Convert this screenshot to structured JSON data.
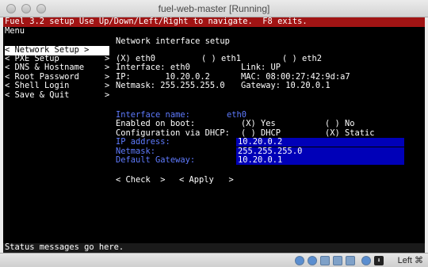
{
  "window": {
    "title": "fuel-web-master [Running]"
  },
  "console": {
    "header": "Fuel 3.2 setup Use Up/Down/Left/Right to navigate.  F8 exits.",
    "menu_label": "Menu",
    "menu": [
      {
        "label": "< Network Setup >",
        "selected": true
      },
      {
        "label": "< PXE Setup",
        "arrow": ">"
      },
      {
        "label": "< DNS & Hostname",
        "arrow": ">"
      },
      {
        "label": "< Root Password",
        "arrow": ">"
      },
      {
        "label": "< Shell Login",
        "arrow": ">"
      },
      {
        "label": "< Save & Quit",
        "arrow": ">"
      }
    ],
    "section_title": "Network interface setup",
    "interfaces": [
      "(X) eth0",
      "( ) eth1",
      "( ) eth2"
    ],
    "summary": {
      "interface": "Interface: eth0",
      "link": "Link: UP",
      "ip": "IP:       10.20.0.2",
      "mac": "MAC: 08:00:27:42:9d:a7",
      "netmask": "Netmask: 255.255.255.0",
      "gateway": "Gateway: 10.20.0.1"
    },
    "form": {
      "interface_name_label": "Interface name:",
      "interface_name_value": "eth0",
      "enabled_label": "Enabled on boot:",
      "enabled_yes": "(X) Yes",
      "enabled_no": "( ) No",
      "dhcp_label": "Configuration via DHCP:",
      "dhcp_option": "( ) DHCP",
      "static_option": "(X) Static",
      "ip_label": "IP address:",
      "ip_value": "10.20.0.2",
      "netmask_label": "Netmask:",
      "netmask_value": "255.255.255.0",
      "gateway_label": "Default Gateway:",
      "gateway_value": "10.20.0.1",
      "check_button": "< Check  >",
      "apply_button": "< Apply   >"
    },
    "status": "Status messages go here."
  },
  "vbox": {
    "host_key": "Left ⌘"
  },
  "colors": {
    "header_bg": "#a11414",
    "console_bg": "#000000",
    "input_bg": "#0000b8",
    "label_blue": "#5f7bff"
  }
}
